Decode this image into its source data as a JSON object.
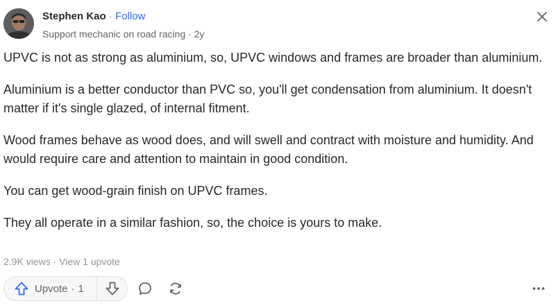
{
  "author": {
    "name": "Stephen Kao",
    "separator": "·",
    "follow_label": "Follow",
    "credential": "Support mechanic on road racing",
    "time": "2y"
  },
  "answer": {
    "paragraphs": [
      "UPVC is not as strong as aluminium, so, UPVC windows and frames are broader than aluminium.",
      "Aluminium is a better conductor than PVC so, you'll get condensation from aluminium. It doesn't matter if it's single glazed, of internal fitment.",
      "Wood frames behave as wood does, and will swell and contract with moisture and humidity. And would require care and attention to maintain in good condition.",
      "You can get wood-grain finish on UPVC frames.",
      "They all operate in a similar fashion, so, the choice is yours to make."
    ]
  },
  "stats": {
    "views": "2.9K views",
    "upvotes_link": "View 1 upvote"
  },
  "actions": {
    "upvote_label": "Upvote",
    "upvote_count": "1"
  },
  "icons": {
    "close": "close-icon",
    "upvote": "upvote-arrow-icon",
    "downvote": "downvote-arrow-icon",
    "comment": "comment-bubble-icon",
    "share": "share-cycle-icon",
    "more": "more-dots-icon"
  },
  "colors": {
    "accent": "#2e69ff",
    "text": "#282829",
    "muted": "#939598"
  }
}
